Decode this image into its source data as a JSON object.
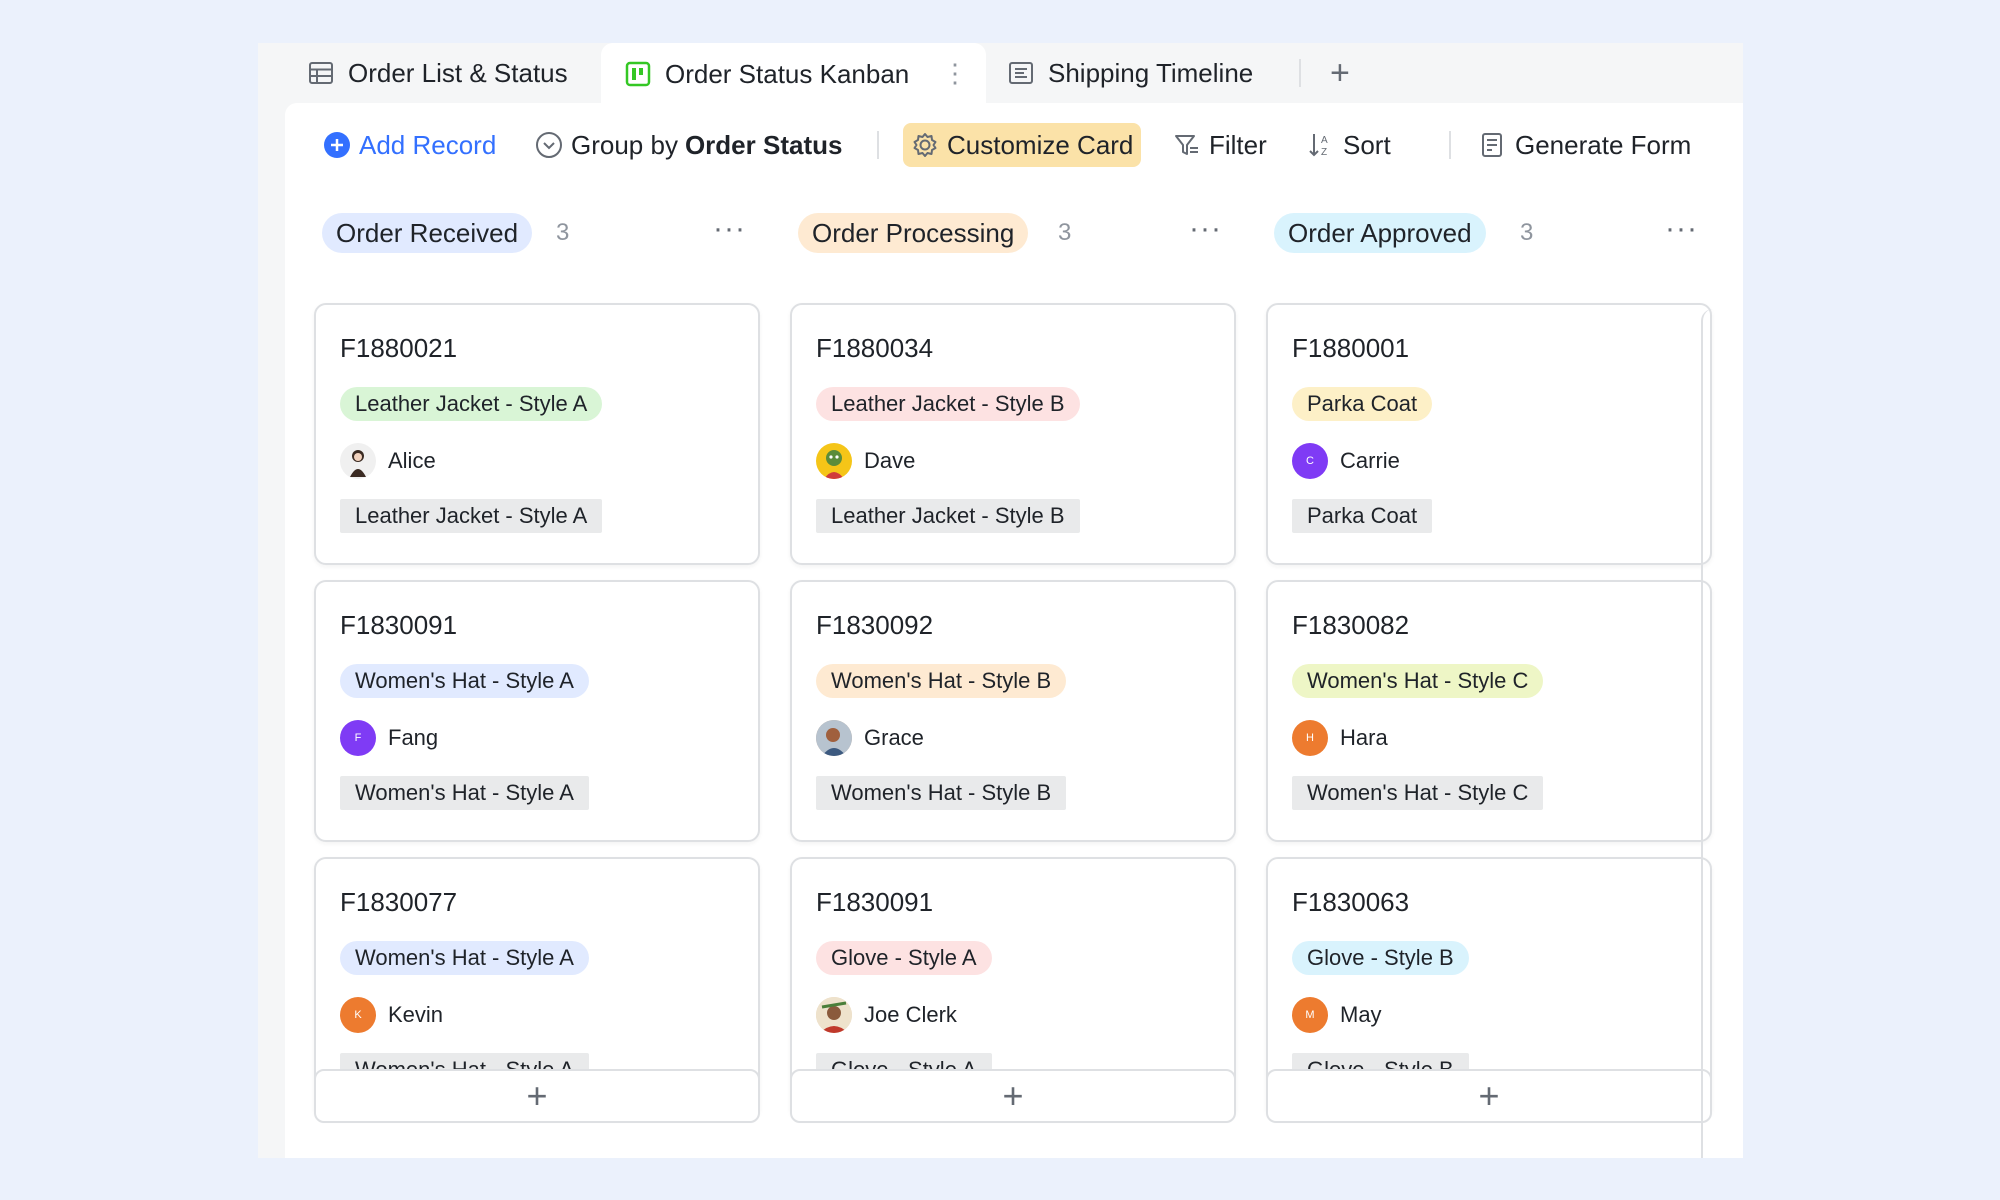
{
  "tabs": [
    {
      "label": "Order List & Status",
      "icon": "table-grid-icon"
    },
    {
      "label": "Order Status Kanban",
      "icon": "kanban-icon",
      "active": true
    },
    {
      "label": "Shipping Timeline",
      "icon": "timeline-icon"
    }
  ],
  "add_tab_label": "+",
  "more_glyph": "⋮",
  "toolbar": {
    "add_record": "Add Record",
    "group_by_prefix": "Group by",
    "group_by_field": "Order Status",
    "customize_card": "Customize Card",
    "filter": "Filter",
    "sort": "Sort",
    "generate_form": "Generate Form"
  },
  "columns": [
    {
      "status": "Order Received",
      "count": "3",
      "pill_color": "#e1eaff",
      "cards": [
        {
          "id": "F1880021",
          "product": "Leather Jacket - Style A",
          "tag_color": "#d9f5d6",
          "person": "Alice",
          "avatar_color": "#f0f0f0",
          "avatar_letter": "",
          "field": "Leather Jacket - Style A"
        },
        {
          "id": "F1830091",
          "product": "Women's Hat - Style A",
          "tag_color": "#e1eaff",
          "person": "Fang",
          "avatar_color": "#7f3bf5",
          "avatar_letter": "F",
          "field": "Women's Hat - Style A"
        },
        {
          "id": "F1830077",
          "product": "Women's Hat - Style A",
          "tag_color": "#e1eaff",
          "person": "Kevin",
          "avatar_color": "#ed7b2f",
          "avatar_letter": "K",
          "field": "Women's Hat - Style A"
        }
      ]
    },
    {
      "status": "Order Processing",
      "count": "3",
      "pill_color": "#feead2",
      "cards": [
        {
          "id": "F1880034",
          "product": "Leather Jacket - Style B",
          "tag_color": "#fde2e2",
          "person": "Dave",
          "avatar_color": "#f5c518",
          "avatar_letter": "",
          "field": "Leather Jacket - Style B"
        },
        {
          "id": "F1830092",
          "product": "Women's Hat - Style B",
          "tag_color": "#feead2",
          "person": "Grace",
          "avatar_color": "#c9a58a",
          "avatar_letter": "",
          "field": "Women's Hat - Style B"
        },
        {
          "id": "F1830091",
          "product": "Glove - Style A",
          "tag_color": "#fde2e2",
          "person": "Joe Clerk",
          "avatar_color": "#e7d3b5",
          "avatar_letter": "",
          "field": "Glove - Style A"
        }
      ]
    },
    {
      "status": "Order Approved",
      "count": "3",
      "pill_color": "#d9f3fd",
      "cards": [
        {
          "id": "F1880001",
          "product": "Parka Coat",
          "tag_color": "#fdf0c7",
          "person": "Carrie",
          "avatar_color": "#7f3bf5",
          "avatar_letter": "C",
          "field": "Parka Coat"
        },
        {
          "id": "F1830082",
          "product": "Women's Hat - Style C",
          "tag_color": "#eef6c6",
          "person": "Hara",
          "avatar_color": "#ed7b2f",
          "avatar_letter": "H",
          "field": "Women's Hat - Style C"
        },
        {
          "id": "F1830063",
          "product": "Glove - Style B",
          "tag_color": "#d9f3fd",
          "person": "May",
          "avatar_color": "#ed7b2f",
          "avatar_letter": "M",
          "field": "Glove - Style B"
        }
      ]
    }
  ],
  "add_card_label": "+",
  "column_more_glyph": "···",
  "colors": {
    "primary": "#3370ff",
    "highlight": "#fbe2a8",
    "kanban_icon": "#34c724"
  }
}
